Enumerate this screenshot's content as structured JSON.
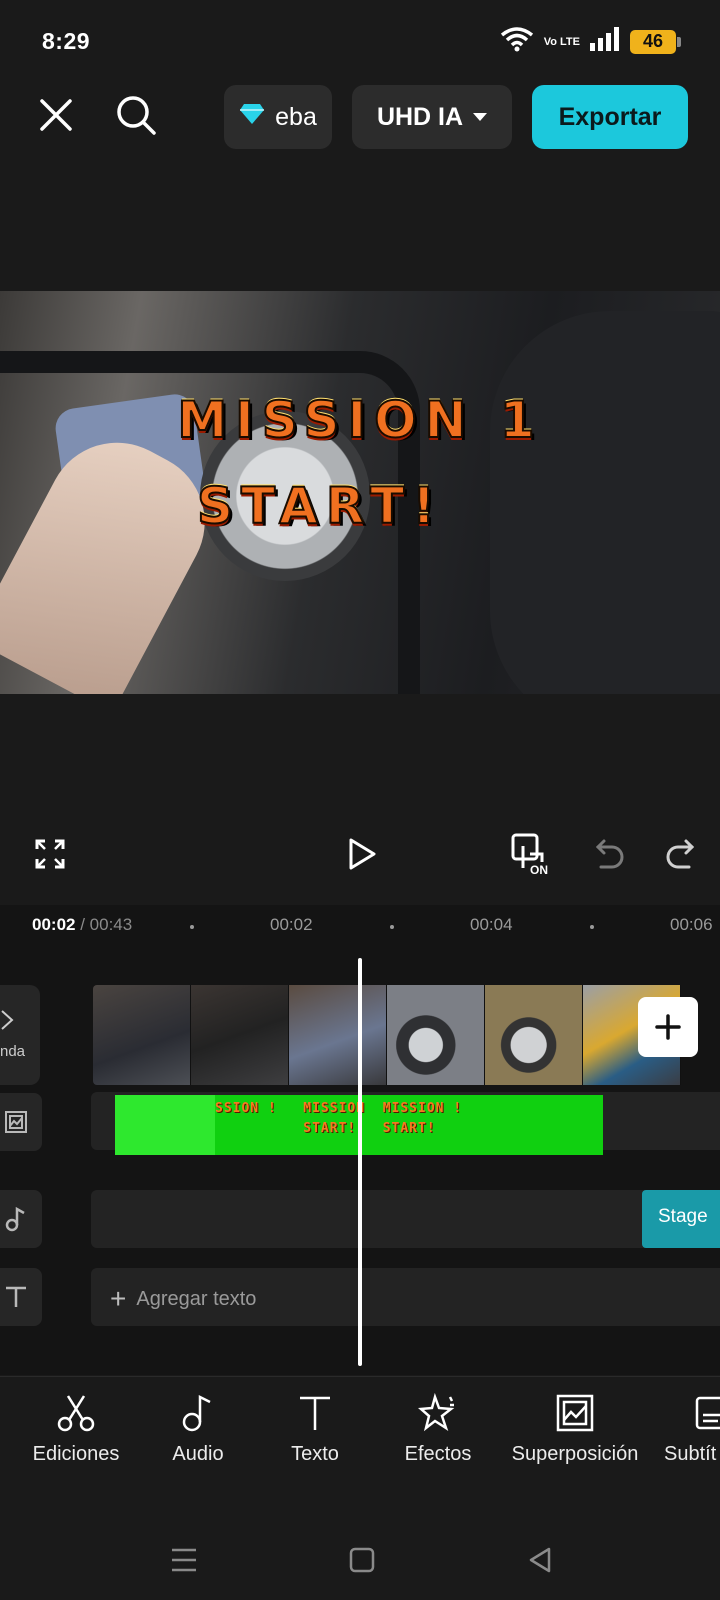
{
  "status_bar": {
    "time": "8:29",
    "network": "Vo LTE",
    "battery": "46"
  },
  "toolbar": {
    "trial_label": "eba",
    "quality_label": "UHD IA",
    "export_label": "Exportar"
  },
  "preview": {
    "overlay_line1": "MISSION 1",
    "overlay_line2": "START!"
  },
  "timeline": {
    "current_time": "00:02",
    "total_time": "/ 00:43",
    "ticks": [
      "00:02",
      "00:04",
      "00:06"
    ],
    "cover_label": "nda",
    "overlay_clip_text": "SSION !   MISSION  MISSION !\n          START!   START!",
    "audio_clip_label": "Stage",
    "add_text_label": "Agregar texto"
  },
  "tools": [
    {
      "label": "Ediciones",
      "icon": "scissors-icon"
    },
    {
      "label": "Audio",
      "icon": "music-note-icon"
    },
    {
      "label": "Texto",
      "icon": "text-icon"
    },
    {
      "label": "Efectos",
      "icon": "effects-star-icon"
    },
    {
      "label": "Superposición",
      "icon": "overlay-icon"
    },
    {
      "label": "Subtít",
      "icon": "subtitles-icon"
    }
  ],
  "colors": {
    "accent": "#1cc8dc",
    "overlay_clip": "#10d010",
    "audio_clip": "#1a9aa8",
    "battery": "#f0b21b"
  }
}
